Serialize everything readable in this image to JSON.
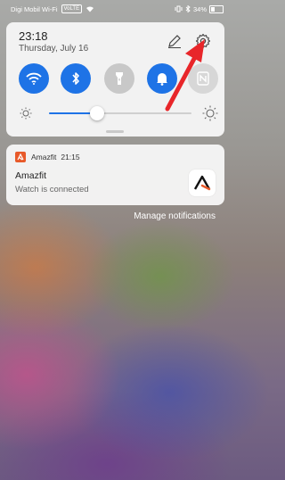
{
  "status_bar": {
    "carrier": "Digi Mobil Wi-Fi",
    "hd_badge": "VoLTE",
    "battery_percent": "34%"
  },
  "quick_settings": {
    "time": "23:18",
    "date": "Thursday, July 16",
    "toggles": [
      {
        "name": "wifi",
        "state": "on"
      },
      {
        "name": "bluetooth",
        "state": "on"
      },
      {
        "name": "flashlight",
        "state": "off"
      },
      {
        "name": "sound",
        "state": "on"
      },
      {
        "name": "nfc",
        "state": "off"
      }
    ],
    "brightness_level": 0.34
  },
  "notification": {
    "app_name": "Amazfit",
    "time": "21:15",
    "title": "Amazfit",
    "body": "Watch is connected"
  },
  "manage_link": "Manage notifications",
  "colors": {
    "accent": "#1e73e6",
    "annotation_arrow": "#e8262a",
    "app_icon": "#e85a2a"
  }
}
